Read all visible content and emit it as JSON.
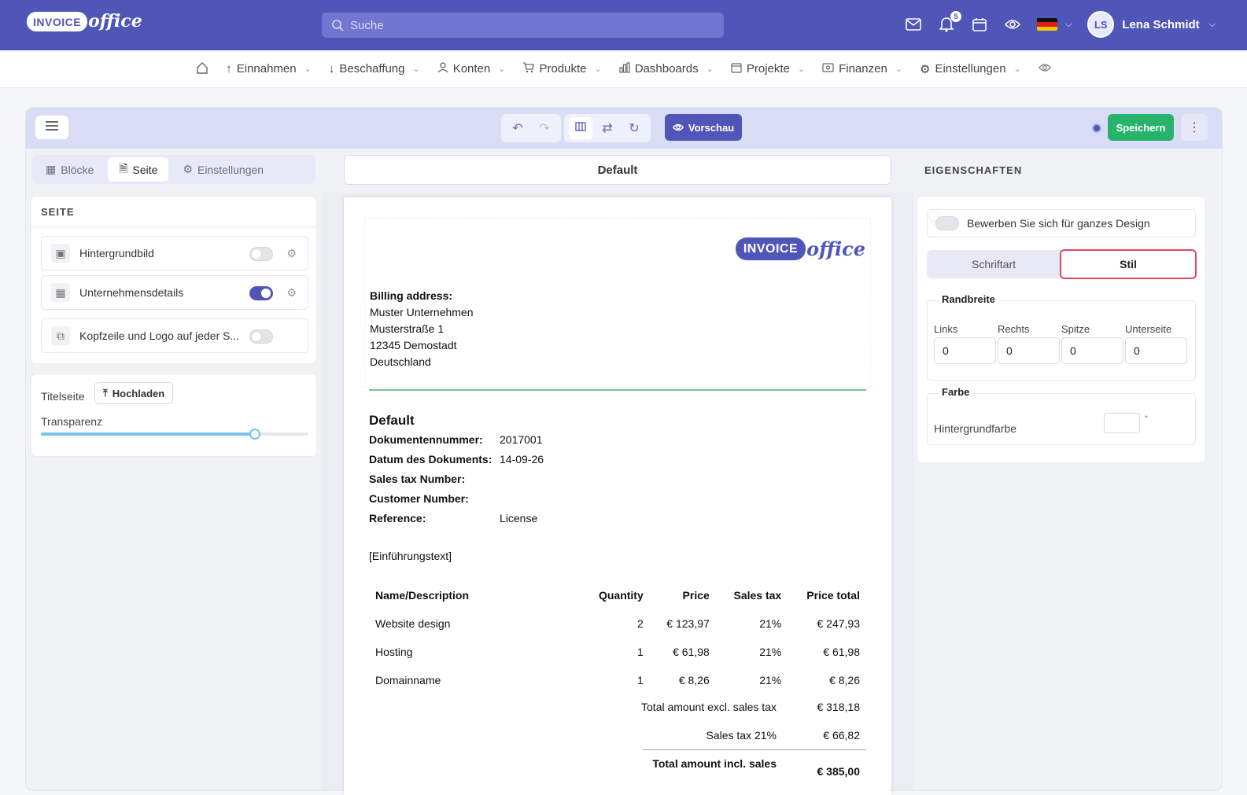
{
  "app": {
    "logo_box": "INVOICE",
    "logo_office": "office",
    "search_placeholder": "Suche",
    "notification_count": "5",
    "user_initials": "LS",
    "user_name": "Lena Schmidt"
  },
  "nav": [
    {
      "label": "Einnahmen",
      "icon": "arrow-up-icon"
    },
    {
      "label": "Beschaffung",
      "icon": "arrow-down-icon"
    },
    {
      "label": "Konten",
      "icon": "user-icon"
    },
    {
      "label": "Produkte",
      "icon": "cart-icon"
    },
    {
      "label": "Dashboards",
      "icon": "chart-icon"
    },
    {
      "label": "Projekte",
      "icon": "calendar-icon"
    },
    {
      "label": "Finanzen",
      "icon": "money-icon"
    },
    {
      "label": "Einstellungen",
      "icon": "gear-icon"
    }
  ],
  "toolbar": {
    "preview_label": "Vorschau",
    "save_label": "Speichern"
  },
  "left": {
    "tabs": [
      "Blöcke",
      "Seite",
      "Einstellungen"
    ],
    "section_title": "SEITE",
    "rows": [
      {
        "label": "Hintergrundbild",
        "on": false
      },
      {
        "label": "Unternehmensdetails",
        "on": true
      },
      {
        "label": "Kopfzeile und Logo auf jeder S...",
        "on": false
      }
    ],
    "title_page_label": "Titelseite",
    "upload_label": "Hochladen",
    "transparency_label": "Transparenz",
    "transparency_value": 0.8
  },
  "doc": {
    "template_name": "Default",
    "billing_label": "Billing address:",
    "address": [
      "Muster Unternehmen",
      "Musterstraße 1",
      "12345 Demostadt",
      "Deutschland"
    ],
    "title": "Default",
    "meta": [
      {
        "k": "Dokumentennummer:",
        "v": "2017001"
      },
      {
        "k": "Datum des Dokuments:",
        "v": "14-09-26"
      },
      {
        "k": "Sales tax Number:",
        "v": ""
      },
      {
        "k": "Customer Number:",
        "v": ""
      },
      {
        "k": "Reference:",
        "v": "License"
      }
    ],
    "intro": "[Einführungstext]",
    "headers": [
      "Name/Description",
      "Quantity",
      "Price",
      "Sales tax",
      "Price total"
    ],
    "items": [
      [
        "Website design",
        "2",
        "€ 123,97",
        "21%",
        "€ 247,93"
      ],
      [
        "Hosting",
        "1",
        "€ 61,98",
        "21%",
        "€ 61,98"
      ],
      [
        "Domainname",
        "1",
        "€ 8,26",
        "21%",
        "€ 8,26"
      ]
    ],
    "totals": [
      {
        "l": "Total amount excl. sales tax",
        "v": "€ 318,18"
      },
      {
        "l": "Sales tax 21%",
        "v": "€ 66,82"
      },
      {
        "l": "Total amount incl. sales",
        "v": "€ 385,00"
      }
    ]
  },
  "right": {
    "title": "EIGENSCHAFTEN",
    "apply_label": "Bewerben Sie sich für ganzes Design",
    "seg": [
      "Schriftart",
      "Stil"
    ],
    "margin_legend": "Randbreite",
    "margin_labels": [
      "Links",
      "Rechts",
      "Spitze",
      "Unterseite"
    ],
    "margin_values": [
      "0",
      "0",
      "0",
      "0"
    ],
    "color_legend": "Farbe",
    "bg_color_label": "Hintergrundfarbe"
  }
}
